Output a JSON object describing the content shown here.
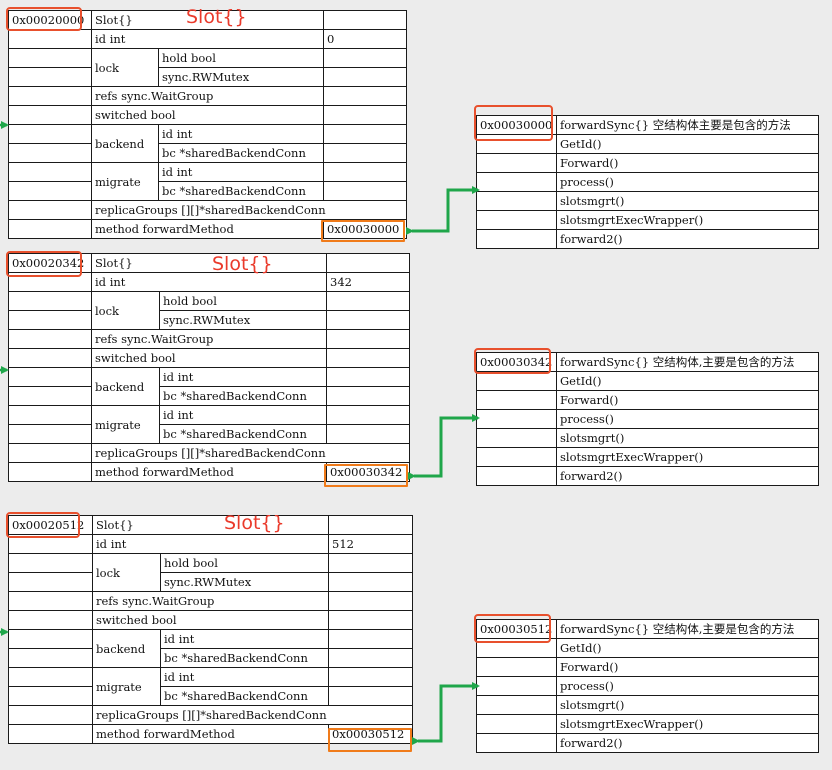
{
  "groups": [
    {
      "slot_addr": "0x00020000",
      "slot_title": "Slot{}",
      "slot_label": "Slot{}",
      "id_field": "id int",
      "id_value": "0",
      "lock_label": "lock",
      "lock_fields": [
        "hold bool",
        "sync.RWMutex"
      ],
      "refs_field": "refs sync.WaitGroup",
      "switched_field": "switched bool",
      "backend_label": "backend",
      "backend_fields": [
        "id int",
        "bc *sharedBackendConn"
      ],
      "migrate_label": "migrate",
      "migrate_fields": [
        "id int",
        "bc *sharedBackendConn"
      ],
      "replica_field": "replicaGroups [][]*sharedBackendConn",
      "method_field": "method forwardMethod",
      "method_value": "0x00030000",
      "fwd_addr": "0x00030000",
      "fwd_title": "forwardSync{} 空结构体主要是包含的方法",
      "fwd_methods": [
        "GetId()",
        "Forward()",
        "process()",
        "slotsmgrt()",
        "slotsmgrtExecWrapper()",
        "forward2()"
      ]
    },
    {
      "slot_addr": "0x00020342",
      "slot_title": "Slot{}",
      "slot_label": "Slot{}",
      "id_field": "id int",
      "id_value": "342",
      "lock_label": "lock",
      "lock_fields": [
        "hold bool",
        "sync.RWMutex"
      ],
      "refs_field": "refs sync.WaitGroup",
      "switched_field": "switched bool",
      "backend_label": "backend",
      "backend_fields": [
        "id int",
        "bc *sharedBackendConn"
      ],
      "migrate_label": "migrate",
      "migrate_fields": [
        "id int",
        "bc *sharedBackendConn"
      ],
      "replica_field": "replicaGroups [][]*sharedBackendConn",
      "method_field": "method forwardMethod",
      "method_value": "0x00030342",
      "fwd_addr": "0x00030342",
      "fwd_title": "forwardSync{} 空结构体,主要是包含的方法",
      "fwd_methods": [
        "GetId()",
        "Forward()",
        "process()",
        "slotsmgrt()",
        "slotsmgrtExecWrapper()",
        "forward2()"
      ]
    },
    {
      "slot_addr": "0x00020512",
      "slot_title": "Slot{}",
      "slot_label": "Slot{}",
      "id_field": "id int",
      "id_value": "512",
      "lock_label": "lock",
      "lock_fields": [
        "hold bool",
        "sync.RWMutex"
      ],
      "refs_field": "refs sync.WaitGroup",
      "switched_field": "switched bool",
      "backend_label": "backend",
      "backend_fields": [
        "id int",
        "bc *sharedBackendConn"
      ],
      "migrate_label": "migrate",
      "migrate_fields": [
        "id int",
        "bc *sharedBackendConn"
      ],
      "replica_field": "replicaGroups [][]*sharedBackendConn",
      "method_field": "method forwardMethod",
      "method_value": "0x00030512",
      "fwd_addr": "0x00030512",
      "fwd_title": "forwardSync{} 空结构体,主要是包含的方法",
      "fwd_methods": [
        "GetId()",
        "Forward()",
        "process()",
        "slotsmgrt()",
        "slotsmgrtExecWrapper()",
        "forward2()"
      ]
    }
  ],
  "colors": {
    "title_blue": "#1f63b8",
    "highlight_red": "#e8502d",
    "method_orange": "#f07b1a",
    "arrow_green": "#1fa64a"
  }
}
